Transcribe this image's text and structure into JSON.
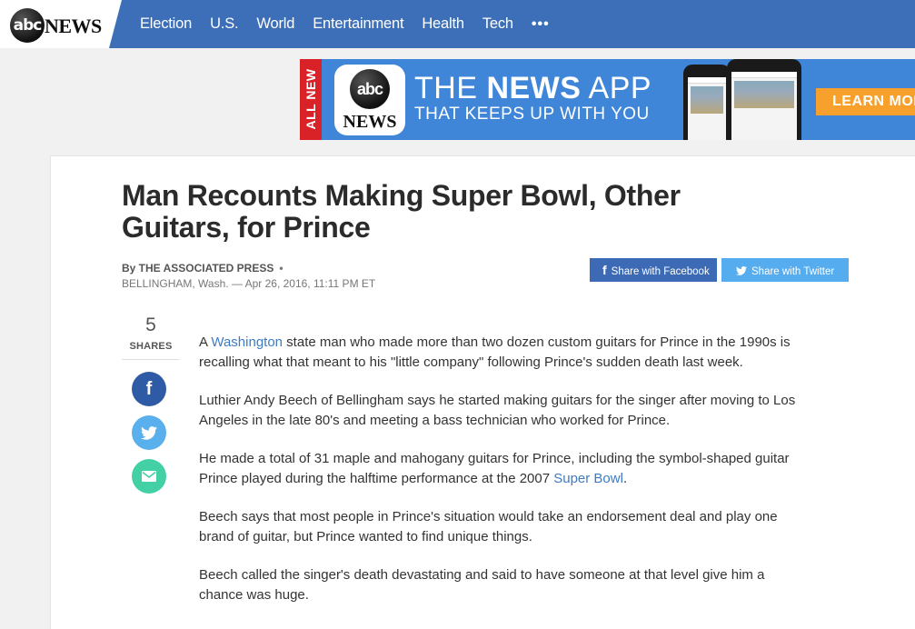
{
  "header": {
    "logo_abc": "abc",
    "logo_news": "NEWS",
    "nav": [
      "Election",
      "U.S.",
      "World",
      "Entertainment",
      "Health",
      "Tech"
    ],
    "more": "•••"
  },
  "ad": {
    "badge": "ALL NEW",
    "icon_abc": "abc",
    "icon_news": "NEWS",
    "line1_pre": "THE ",
    "line1_bold": "NEWS",
    "line1_post": " APP",
    "line2": "THAT KEEPS UP WITH YOU",
    "cta": "LEARN MORE"
  },
  "article": {
    "headline": "Man Recounts Making Super Bowl, Other Guitars, for Prince",
    "byline": "By THE ASSOCIATED PRESS",
    "byline_dot": "•",
    "dateline": "BELLINGHAM, Wash. — Apr 26, 2016, 11:11 PM ET",
    "share_facebook": "Share with Facebook",
    "share_twitter": "Share with Twitter",
    "share_count": "5",
    "share_label": "SHARES",
    "p1_pre": "A ",
    "p1_link": "Washington",
    "p1_post": " state man who made more than two dozen custom guitars for Prince in the 1990s is recalling what that meant to his \"little company\" following Prince's sudden death last week.",
    "p2": "Luthier Andy Beech of Bellingham says he started making guitars for the singer after moving to Los Angeles in the late 80's and meeting a bass technician who worked for Prince.",
    "p3_pre": "He made a total of 31 maple and mahogany guitars for Prince, including the symbol-shaped guitar Prince played during the halftime performance at the 2007 ",
    "p3_link": "Super Bowl",
    "p3_post": ".",
    "p4": "Beech says that most people in Prince's situation would take an endorsement deal and play one brand of guitar, but Prince wanted to find unique things.",
    "p5": "Beech called the singer's death devastating and said to have someone at that level give him a chance was huge."
  },
  "colors": {
    "nav_bg": "#3d6fb8",
    "ad_bg": "#3f86d8",
    "ad_badge": "#d92128",
    "ad_cta": "#f7a02b",
    "facebook": "#3c6ab4",
    "twitter": "#55acee",
    "email": "#44d0a5",
    "link": "#3c7bc6"
  },
  "icons": [
    "facebook-icon",
    "twitter-icon",
    "email-icon",
    "more-dots-icon"
  ]
}
